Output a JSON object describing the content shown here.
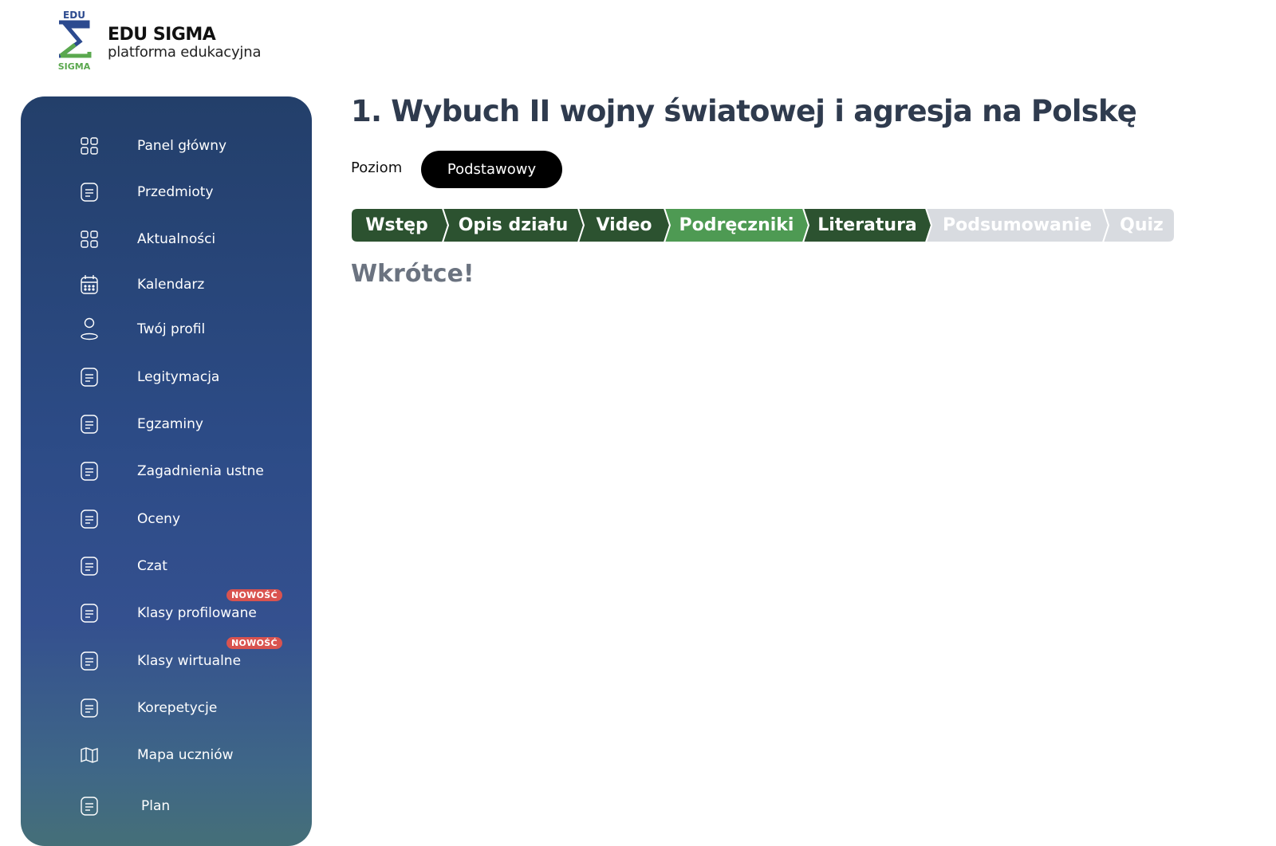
{
  "brand": {
    "mark_top": "EDU",
    "mark_bottom": "SIGMA",
    "title": "EDU SIGMA",
    "subtitle": "platforma edukacyjna"
  },
  "sidebar": {
    "items": [
      {
        "label": "Panel główny",
        "icon": "grid-icon"
      },
      {
        "label": "Przedmioty",
        "icon": "document-icon"
      },
      {
        "label": "Aktualności",
        "icon": "grid-icon"
      },
      {
        "label": "Kalendarz",
        "icon": "calendar-icon"
      },
      {
        "label": "Twój profil",
        "icon": "user-icon"
      },
      {
        "label": "Legitymacja",
        "icon": "document-icon"
      },
      {
        "label": "Egzaminy",
        "icon": "document-icon"
      },
      {
        "label": "Zagadnienia ustne",
        "icon": "document-icon"
      },
      {
        "label": "Oceny",
        "icon": "document-icon"
      },
      {
        "label": "Czat",
        "icon": "document-icon"
      },
      {
        "label": "Klasy profilowane",
        "icon": "document-icon",
        "badge": "NOWOŚĆ"
      },
      {
        "label": "Klasy wirtualne",
        "icon": "document-icon",
        "badge": "NOWOŚĆ"
      },
      {
        "label": "Korepetycje",
        "icon": "document-icon"
      },
      {
        "label": "Mapa uczniów",
        "icon": "map-icon"
      },
      {
        "label": "Plan",
        "icon": "document-icon"
      }
    ]
  },
  "main": {
    "title": "1. Wybuch II wojny światowej i agresja na Polskę",
    "level_label": "Poziom",
    "level_value": "Podstawowy",
    "tabs": [
      {
        "label": "Wstęp",
        "state": "completed"
      },
      {
        "label": "Opis działu",
        "state": "completed"
      },
      {
        "label": "Video",
        "state": "completed"
      },
      {
        "label": "Podręczniki",
        "state": "active"
      },
      {
        "label": "Literatura",
        "state": "completed"
      },
      {
        "label": "Podsumowanie",
        "state": "disabled"
      },
      {
        "label": "Quiz",
        "state": "disabled"
      }
    ],
    "content_message": "Wkrótce!"
  },
  "colors": {
    "tab_completed": "#2c5230",
    "tab_active": "#4e9a53",
    "tab_disabled": "#d8dbe0",
    "badge": "#d9534f",
    "title": "#2f3b4e"
  }
}
